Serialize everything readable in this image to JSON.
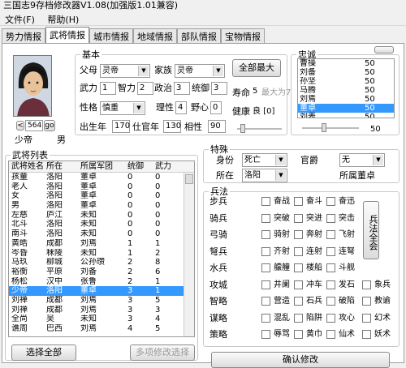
{
  "window": {
    "title": "三国志9存档修改器V1.08(加强版1.01兼容)"
  },
  "menu": [
    "文件(F)",
    "帮助(H)"
  ],
  "tabs": [
    "势力情报",
    "武将情报",
    "城市情报",
    "地域情报",
    "部队情报",
    "宝物情报"
  ],
  "active_tab": 1,
  "portrait": {
    "id": "564",
    "prev": "<",
    "go": "go",
    "name": "少帝",
    "gender": "男"
  },
  "basic": {
    "legend": "基本",
    "father_label": "父母",
    "father_value": "灵帝",
    "family_label": "家族",
    "family_value": "灵帝",
    "wuli_label": "武力",
    "wuli": "1",
    "zhili_label": "智力",
    "zhili": "2",
    "zhengzhi_label": "政治",
    "zhengzhi": "3",
    "tongyu_label": "统御",
    "tongyu": "3",
    "xingge_label": "性格",
    "xingge": "慎重",
    "lixing_label": "理性",
    "lixing": "4",
    "yexin_label": "野心",
    "yexin": "0",
    "birth_label": "出生年",
    "birth": "170",
    "shi_label": "仕官年",
    "shi": "130",
    "xiangxing_label": "相性",
    "xiangxing": "90",
    "maxall": "全部最大",
    "life_label": "寿命",
    "life": "5",
    "life_max": "最大为7",
    "health_label": "健康",
    "health": "良 [0]"
  },
  "loyalty": {
    "legend": "忠诚",
    "items": [
      {
        "name": "曹操",
        "value": "50"
      },
      {
        "name": "刘备",
        "value": "50"
      },
      {
        "name": "孙坚",
        "value": "50"
      },
      {
        "name": "马腾",
        "value": "50"
      },
      {
        "name": "刘焉",
        "value": "50"
      },
      {
        "name": "董卓",
        "value": "50"
      },
      {
        "name": "刘表",
        "value": "50"
      }
    ],
    "selected_value": "50"
  },
  "list": {
    "legend": "武将列表",
    "headers": [
      "武将姓名",
      "所在",
      "所属军团",
      "统御",
      "武力"
    ],
    "rows": [
      [
        "孩童",
        "洛阳",
        "董卓",
        "0",
        "0"
      ],
      [
        "老人",
        "洛阳",
        "董卓",
        "0",
        "0"
      ],
      [
        "女",
        "洛阳",
        "董卓",
        "0",
        "0"
      ],
      [
        "男",
        "洛阳",
        "董卓",
        "0",
        "0"
      ],
      [
        "左慈",
        "庐江",
        "未知",
        "0",
        "0"
      ],
      [
        "北斗",
        "洛阳",
        "未知",
        "0",
        "0"
      ],
      [
        "南斗",
        "洛阳",
        "未知",
        "0",
        "0"
      ],
      [
        "黄皓",
        "成都",
        "刘焉",
        "1",
        "1"
      ],
      [
        "岑昏",
        "秣陵",
        "未知",
        "1",
        "2"
      ],
      [
        "马玖",
        "柳城",
        "公孙瓒",
        "2",
        "8"
      ],
      [
        "裕衡",
        "平原",
        "刘备",
        "2",
        "6"
      ],
      [
        "杨松",
        "汉中",
        "张鲁",
        "2",
        "1"
      ],
      [
        "少帝",
        "洛阳",
        "董卓",
        "3",
        "1"
      ],
      [
        "刘禅",
        "成都",
        "刘焉",
        "3",
        "5"
      ],
      [
        "刘禅",
        "成都",
        "刘焉",
        "3",
        "3"
      ],
      [
        "全尚",
        "吴",
        "未知",
        "3",
        "4"
      ],
      [
        "谯周",
        "巴西",
        "刘焉",
        "4",
        "5"
      ]
    ],
    "selected_index": 12,
    "btn_select_all": "选择全部",
    "btn_multi": "多项修改选择"
  },
  "special": {
    "legend": "特殊",
    "identity_label": "身份",
    "identity": "死亡",
    "official_label": "官爵",
    "official": "无",
    "location_label": "所在",
    "location": "洛阳",
    "faction_label": "所属董卓"
  },
  "bingfa": {
    "legend": "兵法",
    "rows": [
      {
        "label": "步兵",
        "items": [
          "奋战",
          "奋斗",
          "奋迅"
        ]
      },
      {
        "label": "骑兵",
        "items": [
          "突破",
          "突进",
          "突击"
        ]
      },
      {
        "label": "弓骑",
        "items": [
          "骑射",
          "奔射",
          "飞射"
        ]
      },
      {
        "label": "弩兵",
        "items": [
          "齐射",
          "连射",
          "连弩"
        ]
      },
      {
        "label": "水兵",
        "items": [
          "艨艟",
          "楼船",
          "斗舰"
        ]
      },
      {
        "label": "攻城",
        "items": [
          "井阑",
          "冲车",
          "发石",
          "象兵"
        ]
      },
      {
        "label": "智略",
        "items": [
          "营造",
          "石兵",
          "破陷",
          "教谕"
        ]
      },
      {
        "label": "谋略",
        "items": [
          "混乱",
          "陷阱",
          "攻心",
          "幻术"
        ]
      },
      {
        "label": "策略",
        "items": [
          "辱骂",
          "黄巾",
          "仙术",
          "妖术"
        ]
      }
    ],
    "all_btn": "兵法全会"
  },
  "bottom": {
    "modify": "确认修改"
  }
}
